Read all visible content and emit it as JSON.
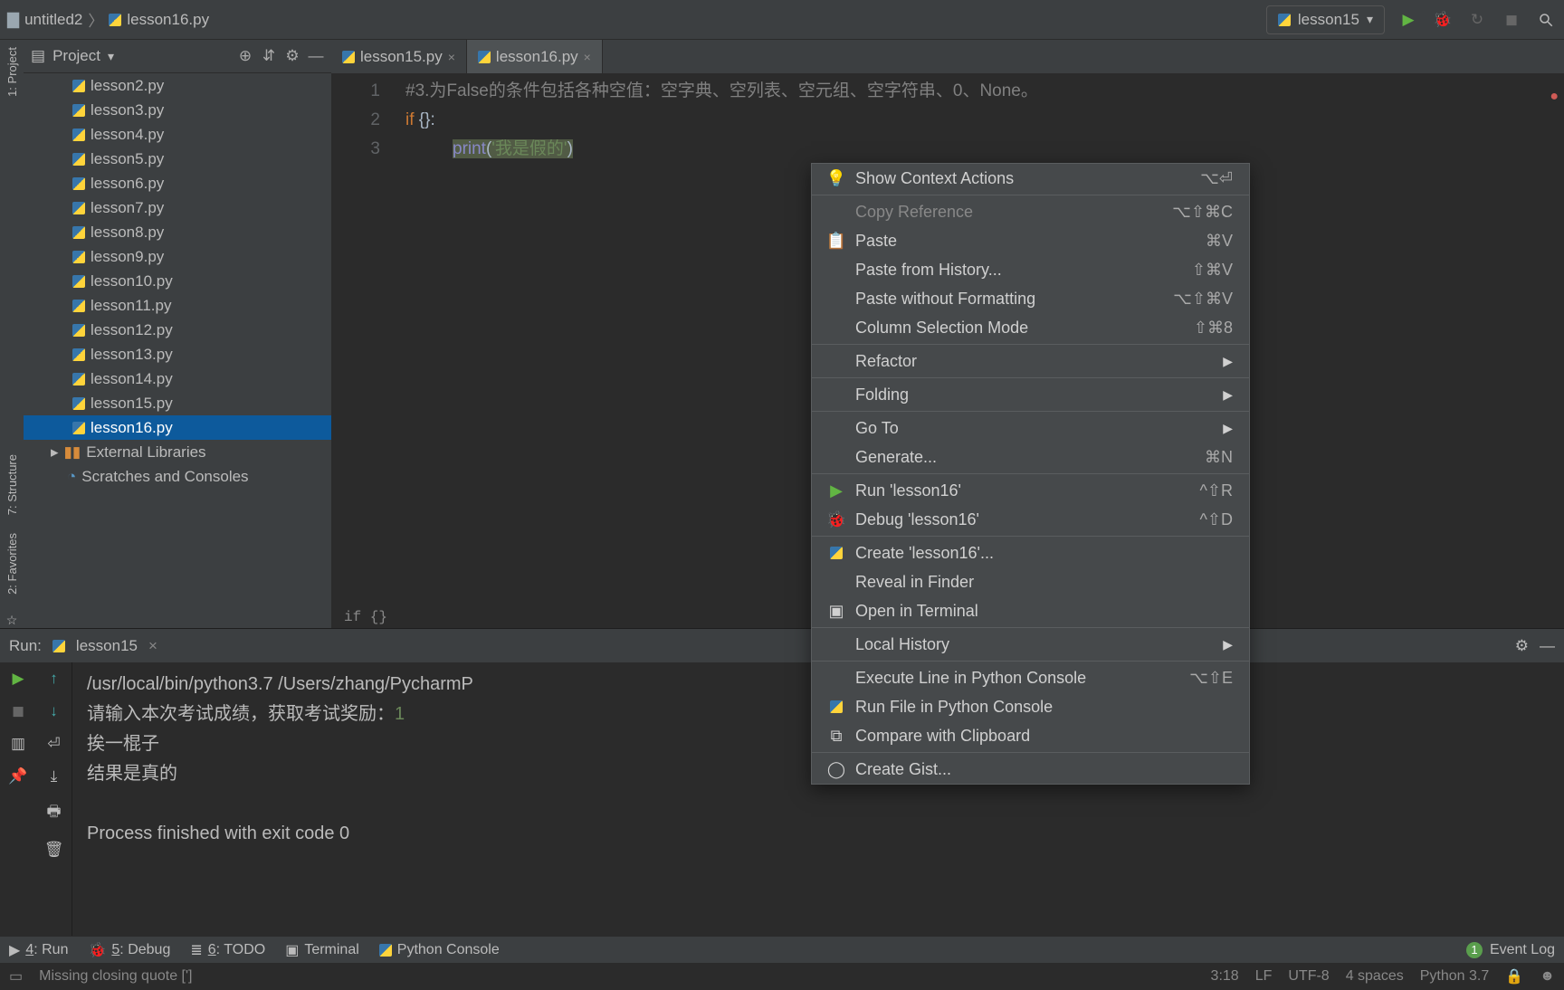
{
  "breadcrumb": {
    "folder": "untitled2",
    "file": "lesson16.py"
  },
  "run_config": {
    "label": "lesson15"
  },
  "left_rail": {
    "project": "1: Project",
    "structure": "7: Structure",
    "favorites": "2: Favorites"
  },
  "project": {
    "title": "Project",
    "files": [
      {
        "name": "lesson2.py"
      },
      {
        "name": "lesson3.py"
      },
      {
        "name": "lesson4.py"
      },
      {
        "name": "lesson5.py"
      },
      {
        "name": "lesson6.py"
      },
      {
        "name": "lesson7.py"
      },
      {
        "name": "lesson8.py"
      },
      {
        "name": "lesson9.py"
      },
      {
        "name": "lesson10.py"
      },
      {
        "name": "lesson11.py"
      },
      {
        "name": "lesson12.py"
      },
      {
        "name": "lesson13.py"
      },
      {
        "name": "lesson14.py"
      },
      {
        "name": "lesson15.py"
      },
      {
        "name": "lesson16.py",
        "selected": true
      }
    ],
    "libs": "External Libraries",
    "scratches": "Scratches and Consoles"
  },
  "tabs": [
    {
      "label": "lesson15.py",
      "active": false
    },
    {
      "label": "lesson16.py",
      "active": true
    }
  ],
  "code": {
    "lines": [
      "1",
      "2",
      "3"
    ],
    "line1_comment": "#3.为False的条件包括各种空值：空字典、空列表、空元组、空字符串、0、None。",
    "line2_if": "if",
    "line2_rest": " {}:",
    "line3_print": "print",
    "line3_open": "(",
    "line3_str": "'我是假的'",
    "line3_close": ")",
    "crumb": "if {}"
  },
  "context_menu": [
    {
      "icon": "bulb",
      "label": "Show Context Actions",
      "shortcut": "⌥⏎"
    },
    {
      "sep": true
    },
    {
      "label": "Copy Reference",
      "shortcut": "⌥⇧⌘C",
      "disabled": true
    },
    {
      "icon": "paste",
      "label": "Paste",
      "shortcut": "⌘V"
    },
    {
      "label": "Paste from History...",
      "shortcut": "⇧⌘V"
    },
    {
      "label": "Paste without Formatting",
      "shortcut": "⌥⇧⌘V"
    },
    {
      "label": "Column Selection Mode",
      "shortcut": "⇧⌘8"
    },
    {
      "sep": true
    },
    {
      "label": "Refactor",
      "sub": true
    },
    {
      "sep": true
    },
    {
      "label": "Folding",
      "sub": true
    },
    {
      "sep": true
    },
    {
      "label": "Go To",
      "sub": true
    },
    {
      "label": "Generate...",
      "shortcut": "⌘N"
    },
    {
      "sep": true
    },
    {
      "icon": "run",
      "label": "Run 'lesson16'",
      "shortcut": "^⇧R"
    },
    {
      "icon": "bug",
      "label": "Debug 'lesson16'",
      "shortcut": "^⇧D"
    },
    {
      "sep": true
    },
    {
      "icon": "py",
      "label": "Create 'lesson16'..."
    },
    {
      "label": "Reveal in Finder"
    },
    {
      "icon": "term",
      "label": "Open in Terminal"
    },
    {
      "sep": true
    },
    {
      "label": "Local History",
      "sub": true
    },
    {
      "sep": true
    },
    {
      "label": "Execute Line in Python Console",
      "shortcut": "⌥⇧E"
    },
    {
      "icon": "py",
      "label": "Run File in Python Console"
    },
    {
      "icon": "diff",
      "label": "Compare with Clipboard"
    },
    {
      "sep": true
    },
    {
      "icon": "gh",
      "label": "Create Gist..."
    }
  ],
  "run": {
    "title": "Run:",
    "config": "lesson15",
    "line1": "/usr/local/bin/python3.7 /Users/zhang/PycharmP",
    "line2a": "请输入本次考试成绩，获取考试奖励：",
    "line2b": "1",
    "line3": "挨一棍子",
    "line4": "结果是真的",
    "line5": "Process finished with exit code 0"
  },
  "bottom_tools": {
    "run": "4: Run",
    "debug": "5: Debug",
    "todo": "6: TODO",
    "terminal": "Terminal",
    "pyconsole": "Python Console",
    "eventlog": "Event Log",
    "event_badge": "1"
  },
  "status": {
    "msg": "Missing closing quote [']",
    "pos": "3:18",
    "sep": "LF",
    "enc": "UTF-8",
    "indent": "4 spaces",
    "py": "Python 3.7"
  }
}
